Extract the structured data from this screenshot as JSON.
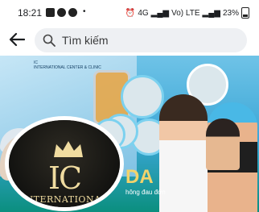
{
  "status_bar": {
    "time": "18:21",
    "notification_dot": "•",
    "signal_4g": "4G",
    "volte_label": "Vo) LTE",
    "battery_percent": "23%"
  },
  "header": {
    "back_icon": "arrow-left-icon",
    "search_placeholder": "Tìm kiếm",
    "search_icon": "search-icon"
  },
  "cover": {
    "clinic_small_logo": "IC",
    "clinic_small_text": "INTERNATIONAL CENTER & CLINIC",
    "band_text": "DA",
    "tagline": "hông đau đớn"
  },
  "avatar": {
    "initials": "IC",
    "label": "INTERNATIONAL"
  },
  "colors": {
    "gold": "#f0dca0",
    "search_bg": "#eef0f3",
    "cover_blue": "#3aa6d6"
  }
}
